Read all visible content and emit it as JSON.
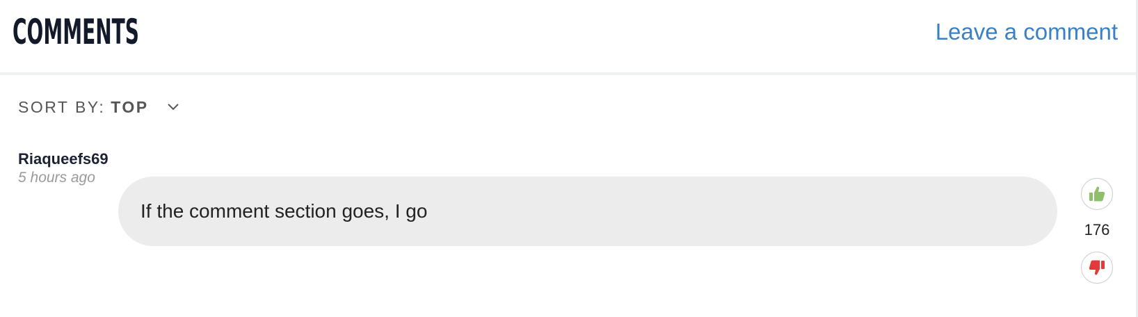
{
  "header": {
    "title": "COMMENTS",
    "leave_comment_label": "Leave a comment"
  },
  "sort": {
    "prefix": "SORT BY:",
    "value": "TOP",
    "icon": "chevron-down-icon"
  },
  "comments": [
    {
      "author": "Riaqueefs69",
      "timestamp": "5 hours ago",
      "text": "If the comment section goes, I go",
      "votes": "176",
      "upvote_icon": "thumbs-up-icon",
      "downvote_icon": "thumbs-down-icon"
    }
  ],
  "colors": {
    "title": "#131a2a",
    "link": "#3a80c6",
    "bubble": "#ececec",
    "upvote": "#8fbf6a",
    "downvote": "#e63a3a"
  }
}
